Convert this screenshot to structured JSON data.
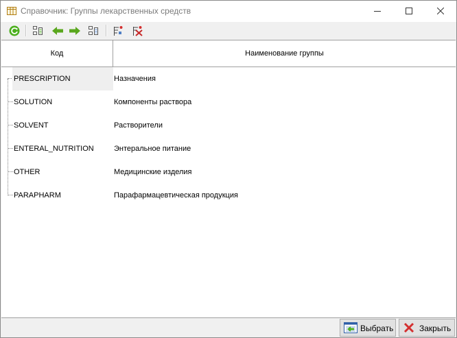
{
  "window": {
    "title": "Справочник: Группы лекарственных средств",
    "controls": [
      "minimize-icon",
      "maximize-icon",
      "close-icon"
    ]
  },
  "toolbar": {
    "buttons": [
      "refresh-icon",
      "tree-expand-icon",
      "arrow-left-icon",
      "arrow-right-icon",
      "tree-collapse-icon",
      "filter-icon",
      "filter-clear-icon"
    ]
  },
  "table": {
    "columns": {
      "code": "Код",
      "name": "Наименование группы"
    },
    "rows": [
      {
        "code": "PRESCRIPTION",
        "name": "Назначения"
      },
      {
        "code": "SOLUTION",
        "name": "Компоненты раствора"
      },
      {
        "code": "SOLVENT",
        "name": "Растворители"
      },
      {
        "code": "ENTERAL_NUTRITION",
        "name": "Энтеральное питание"
      },
      {
        "code": "OTHER",
        "name": "Медицинские изделия"
      },
      {
        "code": "PARAPHARM",
        "name": "Парафармацевтическая продукция"
      }
    ],
    "selected_row": 0
  },
  "buttons": {
    "select": "Выбрать",
    "close": "Закрыть"
  },
  "colors": {
    "accent_green": "#4caf1e",
    "close_red": "#d32f2f"
  }
}
